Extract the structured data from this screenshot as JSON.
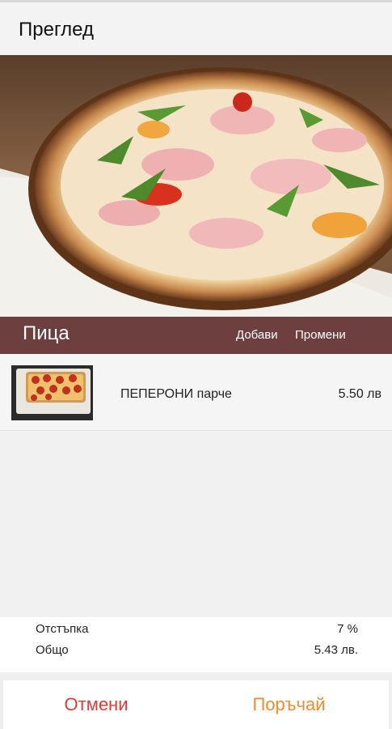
{
  "header": {
    "title": "Преглед"
  },
  "category": {
    "title": "Пица",
    "add_label": "Добави",
    "edit_label": "Промени"
  },
  "order_items": [
    {
      "name": "ПЕПЕРОНИ парче",
      "price": "5.50 лв"
    }
  ],
  "summary": {
    "discount_label": "Отстъпка",
    "discount_value": "7 %",
    "total_label": "Общо",
    "total_value": "5.43 лв."
  },
  "actions": {
    "cancel_label": "Отмени",
    "order_label": "Поръчай"
  },
  "colors": {
    "category_bar": "#6d3f3f",
    "cancel": "#e53935",
    "order": "#f58a2e"
  }
}
